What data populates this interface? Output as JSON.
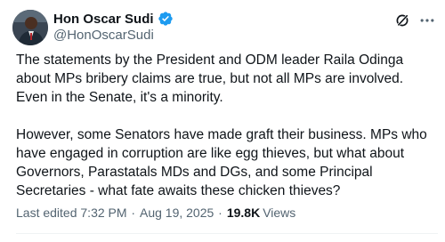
{
  "author": {
    "name": "Hon Oscar Sudi",
    "handle": "@HonOscarSudi",
    "verified": true,
    "verified_color": "#1d9bf0"
  },
  "actions": {
    "grok_icon": "grok-icon",
    "more_icon": "more-options-icon"
  },
  "post": {
    "paragraphs": [
      "The statements by the President and ODM leader Raila Odinga about MPs bribery claims are true, but not all MPs are involved. Even in the Senate, it's a minority.",
      "However, some Senators have made graft their business. MPs who have engaged in corruption are like egg thieves, but what about Governors, Parastatals MDs and DGs, and some Principal Secretaries - what fate awaits these chicken thieves?"
    ]
  },
  "meta": {
    "edited_label": "Last edited",
    "time": "7:32 PM",
    "separator": "·",
    "date": "Aug 19, 2025",
    "views_count": "19.8K",
    "views_label": "Views"
  },
  "colors": {
    "text": "#0f1419",
    "secondary_text": "#536471",
    "accent": "#1d9bf0",
    "divider": "#eff3f4"
  }
}
